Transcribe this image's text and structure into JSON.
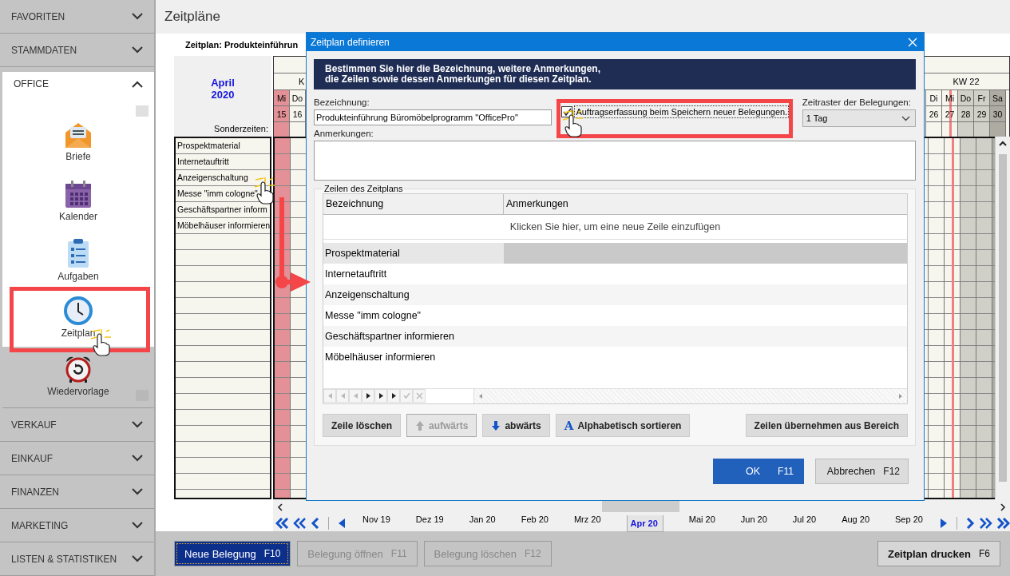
{
  "sidebar": {
    "sections": [
      {
        "label": "FAVORITEN",
        "expanded": false
      },
      {
        "label": "STAMMDATEN",
        "expanded": false
      },
      {
        "label": "OFFICE",
        "expanded": true,
        "items": [
          {
            "label": "Briefe"
          },
          {
            "label": "Kalender"
          },
          {
            "label": "Aufgaben"
          },
          {
            "label": "Zeitplan"
          },
          {
            "label": "Wiedervorlage"
          }
        ]
      },
      {
        "label": "VERKAUF",
        "expanded": false
      },
      {
        "label": "EINKAUF",
        "expanded": false
      },
      {
        "label": "FINANZEN",
        "expanded": false
      },
      {
        "label": "MARKETING",
        "expanded": false
      },
      {
        "label": "LISTEN & STATISTIKEN",
        "expanded": false
      }
    ]
  },
  "page": {
    "title": "Zeitpläne",
    "schedule_title": "Zeitplan: Produkteinführun"
  },
  "calendar": {
    "month": "April",
    "year": "2020",
    "special_label": "Sonderzeiten:",
    "week_left": "K",
    "week_right": "KW 22",
    "days_left": [
      {
        "day": "Mi",
        "date": "15",
        "kind": "special"
      },
      {
        "day": "Do",
        "date": "16",
        "kind": "normal"
      }
    ],
    "days_right": [
      {
        "day": "Di",
        "date": "26",
        "kind": "normal"
      },
      {
        "day": "Mi",
        "date": "27",
        "kind": "today"
      },
      {
        "day": "Do",
        "date": "28",
        "kind": "outside"
      },
      {
        "day": "Fr",
        "date": "29",
        "kind": "outside"
      },
      {
        "day": "Sa",
        "date": "30",
        "kind": "weekend"
      }
    ],
    "rows": [
      "Prospektmaterial",
      "Internetauftritt",
      "Anzeigenschaltung",
      "Messe \"imm cologne\"",
      "Geschäftspartner inform",
      "Möbelhäuser informieren"
    ]
  },
  "month_nav": {
    "months": [
      {
        "label": "Nov 19",
        "selected": false
      },
      {
        "label": "Dez 19",
        "selected": false
      },
      {
        "label": "Jan 20",
        "selected": false
      },
      {
        "label": "Feb 20",
        "selected": false
      },
      {
        "label": "Mrz 20",
        "selected": false
      },
      {
        "label": "Apr 20",
        "selected": true
      },
      {
        "label": "Mai 20",
        "selected": false
      },
      {
        "label": "Jun 20",
        "selected": false
      },
      {
        "label": "Jul 20",
        "selected": false
      },
      {
        "label": "Aug 20",
        "selected": false
      },
      {
        "label": "Sep 20",
        "selected": false
      }
    ]
  },
  "dialog": {
    "title": "Zeitplan definieren",
    "banner": [
      "Bestimmen Sie hier die Bezeichnung, weitere Anmerkungen,",
      "die Zeilen sowie dessen Anmerkungen für diesen Zeitplan."
    ],
    "name_label": "Bezeichnung:",
    "name_value": "Produkteinführung Büromöbelprogramm \"OfficePro\"",
    "checkbox": {
      "label": "Auftragserfassung beim Speichern neuer Belegungen.",
      "checked": true
    },
    "raster_label": "Zeitraster der Belegungen:",
    "raster_value": "1 Tag",
    "notes_label": "Anmerkungen:",
    "group_label": "Zeilen des Zeitplans",
    "columns": [
      "Bezeichnung",
      "Anmerkungen"
    ],
    "new_row_hint": "Klicken Sie hier, um eine neue Zeile einzufügen",
    "rows": [
      {
        "name": "Prospektmaterial",
        "selected": true
      },
      {
        "name": "Internetauftritt",
        "selected": false
      },
      {
        "name": "Anzeigenschaltung",
        "selected": false
      },
      {
        "name": "Messe \"imm cologne\"",
        "selected": false
      },
      {
        "name": "Geschäftspartner informieren",
        "selected": false
      },
      {
        "name": "Möbelhäuser informieren",
        "selected": false
      }
    ],
    "buttons": [
      {
        "label": "Zeile löschen",
        "kind": "plain",
        "disabled": false
      },
      {
        "label": "aufwärts",
        "kind": "up",
        "disabled": true
      },
      {
        "label": "abwärts",
        "kind": "down",
        "disabled": false
      },
      {
        "label": "Alphabetisch sortieren",
        "kind": "sort",
        "glyph": "A",
        "disabled": false
      },
      {
        "label": "Zeilen übernehmen aus Bereich",
        "kind": "plain",
        "disabled": false
      }
    ],
    "ok": {
      "label": "OK",
      "key": "F11"
    },
    "cancel": {
      "label": "Abbrechen",
      "key": "F12"
    }
  },
  "actions": [
    {
      "label": "Neue Belegung",
      "key": "F10",
      "kind": "primary",
      "disabled": false
    },
    {
      "label": "Belegung öffnen",
      "key": "F11",
      "kind": "plain",
      "disabled": true
    },
    {
      "label": "Belegung löschen",
      "key": "F12",
      "kind": "plain",
      "disabled": true
    },
    {
      "label": "Zeitplan drucken",
      "key": "F6",
      "kind": "plain",
      "disabled": false
    }
  ]
}
